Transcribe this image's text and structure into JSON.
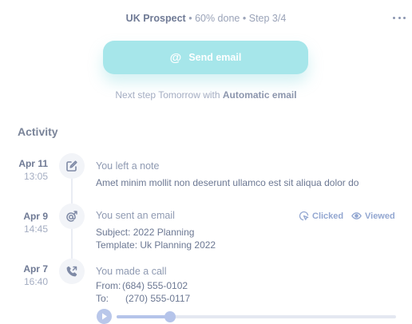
{
  "header": {
    "prospect_name": "UK Prospect",
    "progress_text": "60% done",
    "step_text": "Step 3/4",
    "separator": "•"
  },
  "primary_action": {
    "label": "Send email",
    "icon": "at-icon"
  },
  "next_step": {
    "prefix": "Next step Tomorrow with",
    "method": "Automatic email"
  },
  "activity": {
    "title": "Activity",
    "items": [
      {
        "date": "Apr 11",
        "time": "13:05",
        "icon": "edit-note-icon",
        "title": "You left a note",
        "body": "Amet minim mollit non deserunt ullamco est sit aliqua dolor do"
      },
      {
        "date": "Apr 9",
        "time": "14:45",
        "icon": "email-sent-icon",
        "title": "You sent an email",
        "subject": "Subject: 2022 Planning",
        "template": "Template: Uk Planning 2022",
        "badges": {
          "clicked": "Clicked",
          "viewed": "Viewed"
        }
      },
      {
        "date": "Apr 7",
        "time": "16:40",
        "icon": "phone-call-icon",
        "title": "You made a call",
        "from_label": "From:",
        "from_value": "(684) 555-0102",
        "to_label": "To:",
        "to_value": "(270) 555-0117",
        "recording_progress": 0.19
      }
    ]
  },
  "colors": {
    "accent": "#a6e6ea",
    "badge": "#93a7d1",
    "player": "#b5c4ea"
  }
}
